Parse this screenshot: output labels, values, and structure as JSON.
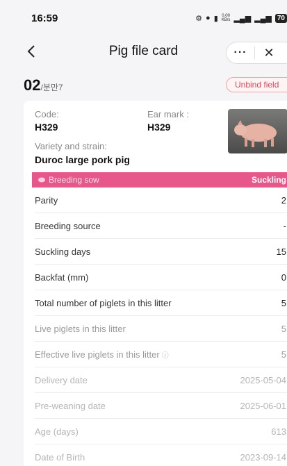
{
  "status_bar": {
    "time": "16:59",
    "speed_top": "0.00",
    "speed_bottom": "KB/s",
    "battery": "70"
  },
  "nav": {
    "title": "Pig file card",
    "more": "···",
    "close": "✕"
  },
  "header": {
    "pig_number": "02",
    "pig_suffix": "/분만7",
    "unbind_label": "Unbind field"
  },
  "card": {
    "code_label": "Code:",
    "code_value": "H329",
    "ear_label": "Ear mark :",
    "ear_value": "H329",
    "variety_label": "Variety and strain:",
    "variety_value": "Duroc large pork pig",
    "status_left": "Breeding sow",
    "status_right": "Suckling"
  },
  "rows": [
    {
      "label": "Parity",
      "value": "2"
    },
    {
      "label": "Breeding source",
      "value": "-"
    },
    {
      "label": "Suckling days",
      "value": "15"
    },
    {
      "label": "Backfat (mm)",
      "value": "0"
    },
    {
      "label": "Total number of piglets in this litter",
      "value": "5"
    },
    {
      "label": "Live piglets in this litter",
      "value": "5"
    },
    {
      "label": "Effective live piglets in this litter",
      "value": "5"
    },
    {
      "label": "Delivery date",
      "value": "2025-05-04"
    },
    {
      "label": "Pre-weaning date",
      "value": "2025-06-01"
    },
    {
      "label": "Age (days)",
      "value": "613"
    },
    {
      "label": "Date of Birth",
      "value": "2023-09-14"
    }
  ],
  "colors": {
    "accent_pink": "#e8578a",
    "unbind_red": "#e04a5a"
  }
}
